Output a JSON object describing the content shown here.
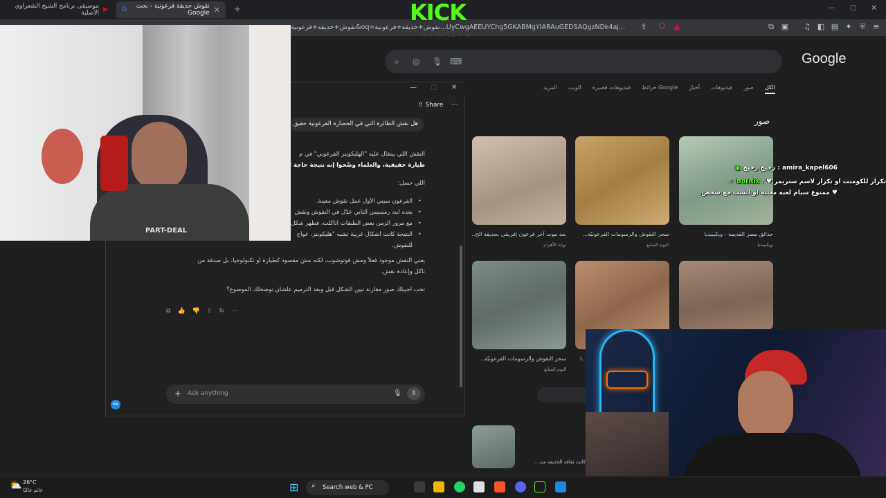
{
  "browser": {
    "tabs": [
      {
        "label": "موسيقى برنامج الشيخ الشعراوي الاصلية",
        "active": false
      },
      {
        "label": "نقوش حديقة فرعونية - بحث Google",
        "active": true
      }
    ],
    "url": "نقوش+حديقة+فرعونية&oq=نقوش+حديقة+فرعونية...UyCwgAEEUYChg5GKABMgYIARAuGEDSAQgzNDk4aj..."
  },
  "google": {
    "logo": "Google",
    "tabs": [
      "الكل",
      "صور",
      "فيديوهات",
      "أخبار",
      "خرائط Google",
      "فيديوهات قصيرة",
      "الويب",
      "المزيد"
    ],
    "active_tab": "الكل",
    "images_heading": "صور",
    "results": [
      {
        "caption": "حدائق مصر القديمة - ويكيبيديا",
        "source": "ويكيبيديا"
      },
      {
        "caption": "سحر النقوش والرسومات الفرعونيّة...",
        "source": "اليوم السابع"
      },
      {
        "caption": "بعد موت آخر فرعون إفريقي بحديقة الح...",
        "source": "بوابة الأهرام"
      },
      {
        "caption": "",
        "source": ""
      },
      {
        "caption": "...ا",
        "source": ""
      },
      {
        "caption": "سحر النقوش والرسومات الفرعونيّة...",
        "source": "اليوم السابع"
      }
    ],
    "bottom_caption": "كانت ثقافة الحديقة مند..."
  },
  "chatgpt": {
    "share_label": "Share",
    "question": "هل نقش الطائرة التي في الحضارة الفرعونية حقيق",
    "answer_lines": [
      "النقش اللي بيتقال عليه \"الهليكوبتر الفرعوني\" في م",
      "طيارة حقيقية، والعلماء وضّحوا إنه نتيجة حاجة اسمها",
      "اللي حصل:",
      "الفرعون سيتي الأول عمل نقوش معينة.",
      "بعده ابنه رمسيس الثاني عدّل في النقوش ونقش",
      "مع مرور الزمن بعض الطبقات اتآكلت، فظهر شكل",
      "النتيجة كانت أشكال غريبة تشبه \"هليكوبتر، عواج",
      "للنقوش.",
      "يعني النقش موجود فعلاً ومش فوتوشوب، لكنه مش مقصود كطيارة أو تكنولوجيا، بل صدفة من",
      "تآكل وإعادة نقش.",
      "تحب أجيبلك صور مقارنة تبين الشكل قبل وبعد الترميم علشان توضحلك الموضوع؟"
    ],
    "composer_placeholder": "Ask anything",
    "avatar": "MA"
  },
  "stream": {
    "logo": "KICK",
    "sub": "M7AME7O",
    "chat": [
      {
        "user": "amira_kapel606",
        "message": "زحيح زحيح"
      },
      {
        "user": "BotRix",
        "message": "تكرار للكومنت او تكرار لاسم ستريمر ♥"
      },
      {
        "user": "",
        "message": "♥ ممنوع سبام لعبه معينه او السب مع شخص"
      }
    ]
  },
  "taskbar": {
    "temp": "26°C",
    "weather": "غائم غالبًا",
    "search": "Search web & PC"
  },
  "colors": {
    "kick_green": "#53fc18",
    "accent_blue": "#1e88e5"
  }
}
